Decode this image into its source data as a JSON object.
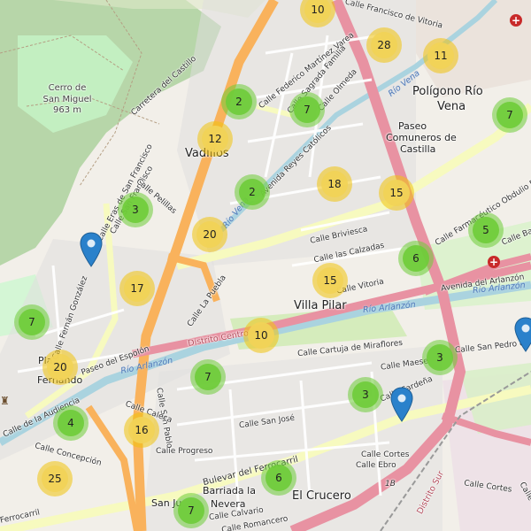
{
  "map": {
    "colors": {
      "land": "#f2efe9",
      "river": "#aad3df",
      "road_major": "#f9b25c",
      "road_trunk": "#e892a2",
      "road_secondary": "#f7fabf",
      "park": "#c8facc",
      "forest": "#add19e",
      "cluster_small": "#6ecc39",
      "cluster_medium": "#f0c20c",
      "pin": "#2a81cb"
    },
    "places": [
      {
        "id": "vadillos",
        "text": "Vadillos",
        "size": "big"
      },
      {
        "id": "villa-pilar",
        "text": "Villa Pilar",
        "size": "big"
      },
      {
        "id": "poligono-1",
        "text": "Polígono Río",
        "size": "big"
      },
      {
        "id": "poligono-2",
        "text": "Vena",
        "size": "big"
      },
      {
        "id": "el-crucero",
        "text": "El Crucero",
        "size": "big"
      },
      {
        "id": "paseo-comuneros-1",
        "text": "Paseo",
        "size": "med"
      },
      {
        "id": "paseo-comuneros-2",
        "text": "Comuneros de",
        "size": "med"
      },
      {
        "id": "paseo-comuneros-3",
        "text": "Castilla",
        "size": "med"
      },
      {
        "id": "barriada-1",
        "text": "Barriada la",
        "size": "med"
      },
      {
        "id": "barriada-2",
        "text": "Nevera",
        "size": "med"
      },
      {
        "id": "fernando-1",
        "text": "Pla",
        "size": "med"
      },
      {
        "id": "fernando-2",
        "text": "Fernando",
        "size": "med"
      },
      {
        "id": "san-ju",
        "text": "San Ju",
        "size": "med"
      }
    ],
    "peak": {
      "name": "Cerro de San Miguel",
      "elevation": "963 m",
      "line1": "Cerro de",
      "line2": "San Miguel"
    },
    "water_labels": [
      "Río Vena",
      "Río Arlanzón",
      "Río Arlanzón",
      "Río Arlanzón",
      "Río Vena"
    ],
    "district_labels": [
      "Distrito Centro",
      "Distrito Sur"
    ],
    "road_shields": [
      "1B"
    ],
    "streets": [
      "Calle Francisco de Vitoria",
      "Calle Federico Martínez Varea",
      "Calle Sagrada Familia",
      "Calle Olmeda",
      "Carretera del Castillo",
      "Calle Eras de San Francisco",
      "Calle San Francisco",
      "Calle Pelillas",
      "Avenida Reyes Católicos",
      "Calle Briviesca",
      "Calle las Calzadas",
      "Calle Vitoria",
      "Calle La Puebla",
      "Calle Fernán González",
      "Paseo del Espolón",
      "Calle Cartuja de Miraflores",
      "Calle Maese",
      "Calle Cardeña",
      "Calle San Pedro de",
      "Calle San José",
      "Calle Progreso",
      "Calle Concepción",
      "Calle de la Audiencia",
      "Calle Ebro",
      "Calle Cortes",
      "Bulevar del Ferrocarril",
      "Calle Calvario",
      "Calle Romancero",
      "Avenida del Arlanzón",
      "Calle Farmacéutico Obdulio Fernández",
      "Calle Bailé",
      "Calle Cortes",
      "Calle San Pablo",
      "Calle Caleca",
      "Ferrocarril",
      "Calle Gamonal"
    ],
    "clusters": [
      {
        "count": "10",
        "level": "medium"
      },
      {
        "count": "28",
        "level": "medium"
      },
      {
        "count": "11",
        "level": "medium"
      },
      {
        "count": "2",
        "level": "small"
      },
      {
        "count": "7",
        "level": "small"
      },
      {
        "count": "7",
        "level": "small"
      },
      {
        "count": "12",
        "level": "medium"
      },
      {
        "count": "2",
        "level": "small"
      },
      {
        "count": "18",
        "level": "medium"
      },
      {
        "count": "15",
        "level": "medium"
      },
      {
        "count": "3",
        "level": "small"
      },
      {
        "count": "20",
        "level": "medium"
      },
      {
        "count": "5",
        "level": "small"
      },
      {
        "count": "6",
        "level": "small"
      },
      {
        "count": "17",
        "level": "medium"
      },
      {
        "count": "15",
        "level": "medium"
      },
      {
        "count": "7",
        "level": "small"
      },
      {
        "count": "10",
        "level": "medium"
      },
      {
        "count": "20",
        "level": "medium"
      },
      {
        "count": "7",
        "level": "small"
      },
      {
        "count": "3",
        "level": "small"
      },
      {
        "count": "3",
        "level": "small"
      },
      {
        "count": "4",
        "level": "small"
      },
      {
        "count": "16",
        "level": "medium"
      },
      {
        "count": "25",
        "level": "medium"
      },
      {
        "count": "6",
        "level": "small"
      },
      {
        "count": "7",
        "level": "small"
      }
    ],
    "pins": [
      "location-pin",
      "location-pin",
      "location-pin"
    ],
    "icons": {
      "hospital": "hospital-cross-icon",
      "landmark": "castle-icon"
    }
  }
}
